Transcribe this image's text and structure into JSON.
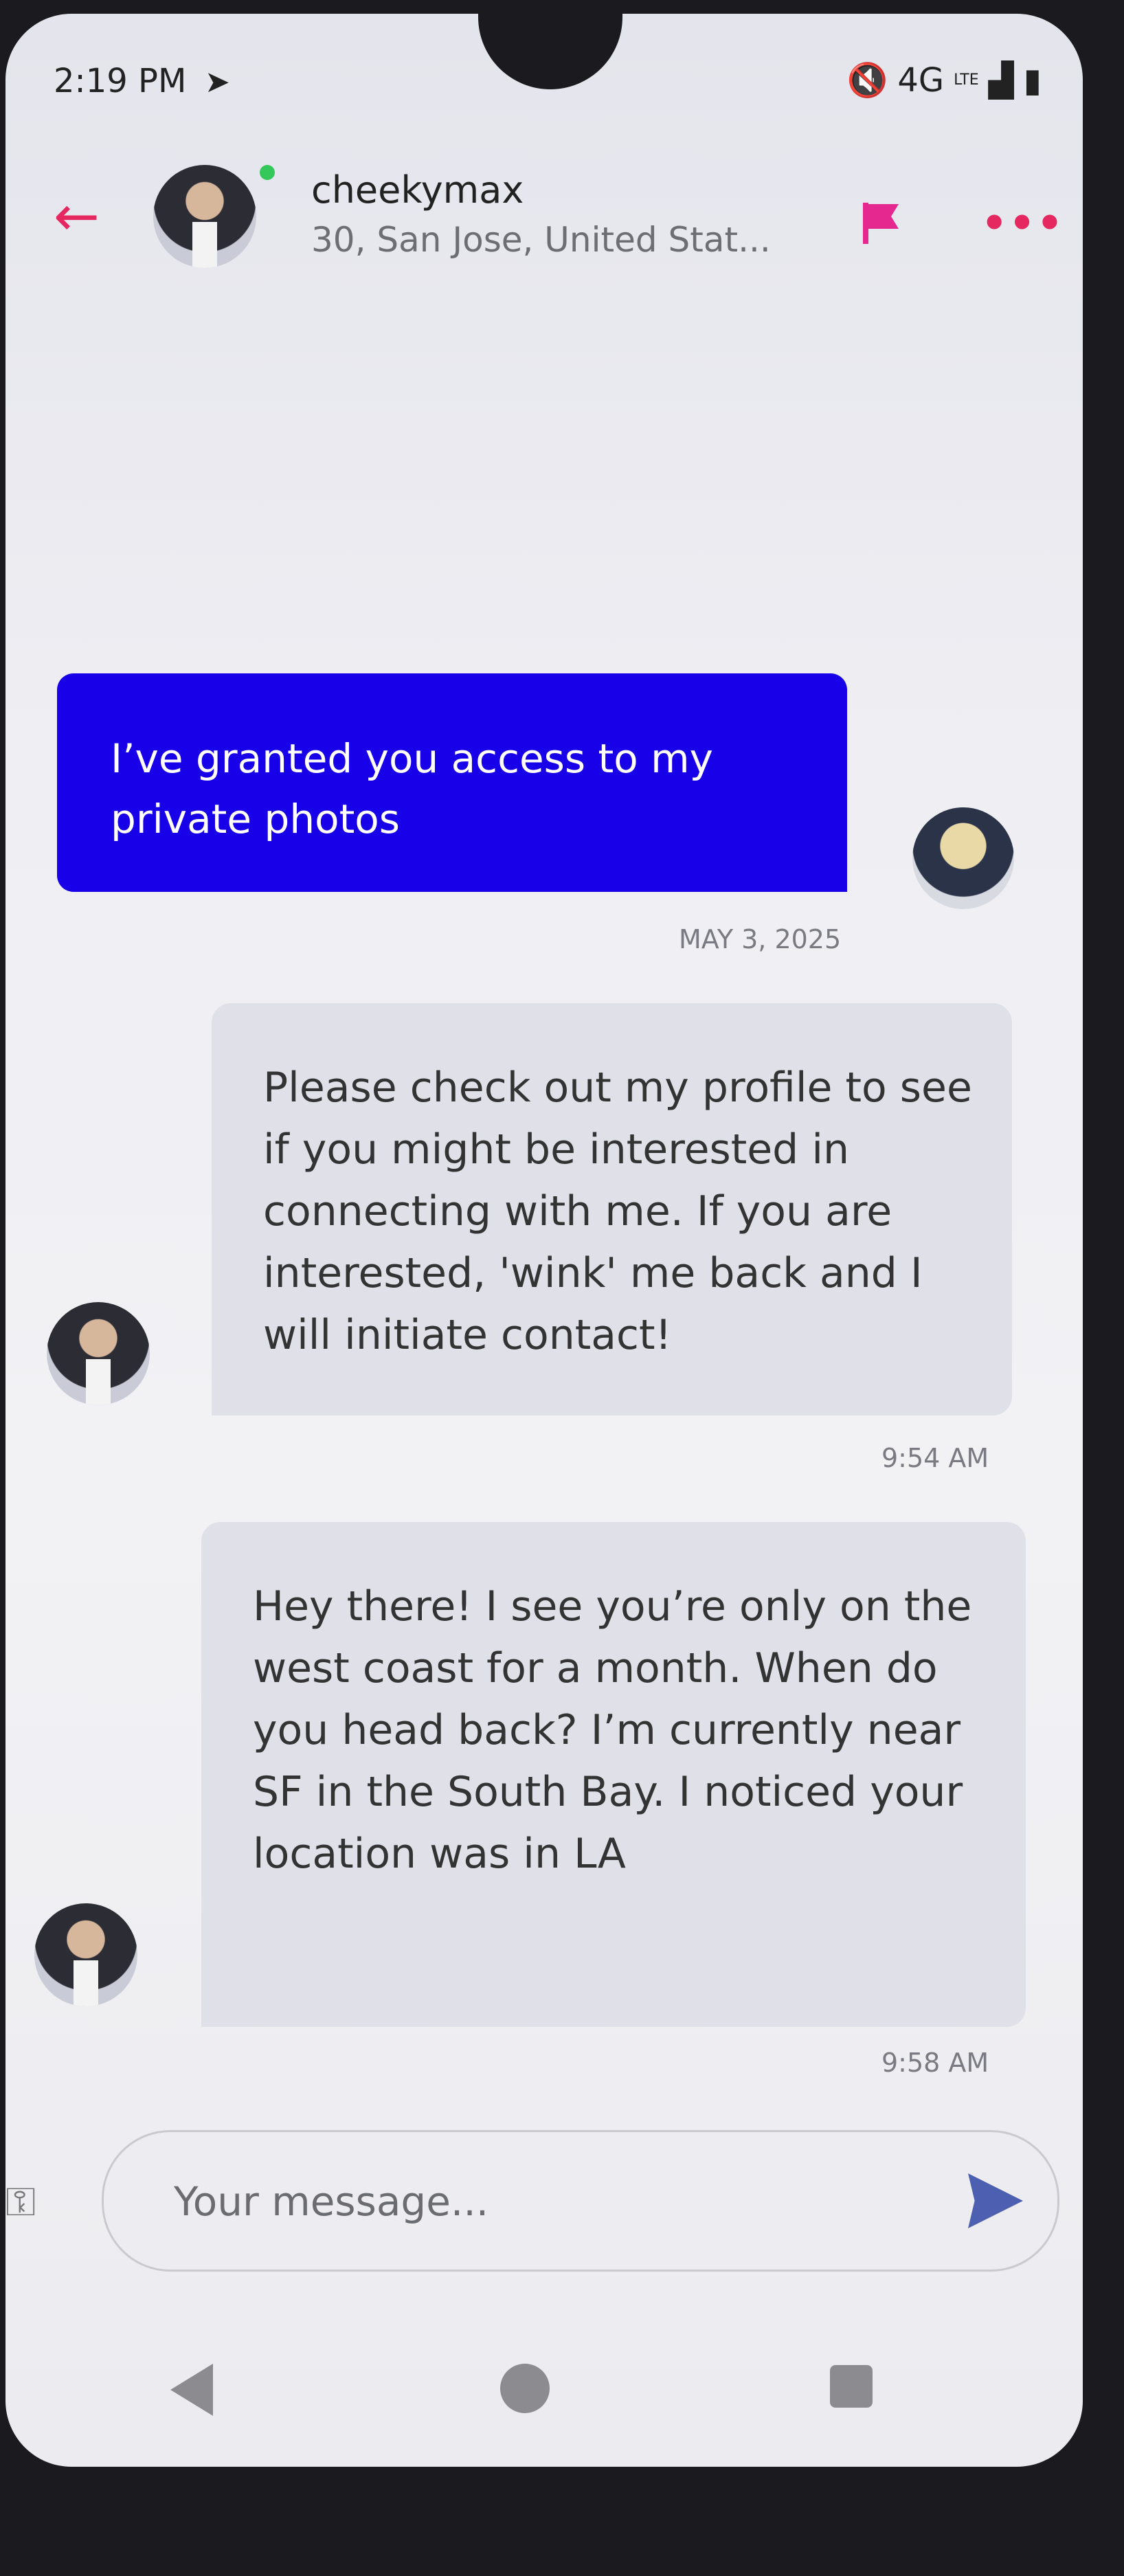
{
  "status_bar": {
    "time": "2:19 PM",
    "network": "4G",
    "lte": "LTE",
    "icons": [
      "telegram-icon",
      "mute-icon",
      "signal-icon",
      "battery-icon"
    ]
  },
  "header": {
    "name": "cheekymax",
    "subtitle": "30, San Jose, United Stat...",
    "online": true
  },
  "messages": {
    "outgoing_1": "I’ve granted you access to my private photos",
    "date_1": "MAY 3, 2025",
    "incoming_1": "Please check out my profile to see if you might be interested in connecting with me. If you are interested, 'wink' me back and I will initiate contact!",
    "time_1": "9:54 AM",
    "incoming_2": "Hey there! I see you’re only on the west coast for a month. When do you head back? I’m currently near SF in the South Bay. I noticed your location was in LA",
    "time_2": "9:58 AM"
  },
  "composer": {
    "placeholder": "Your message..."
  },
  "colors": {
    "accent": "#e5285f",
    "flag": "#e5288f",
    "outgoing_bubble": "#1800e8",
    "incoming_bubble": "#dfe0e8",
    "send": "#4c5fb0"
  }
}
